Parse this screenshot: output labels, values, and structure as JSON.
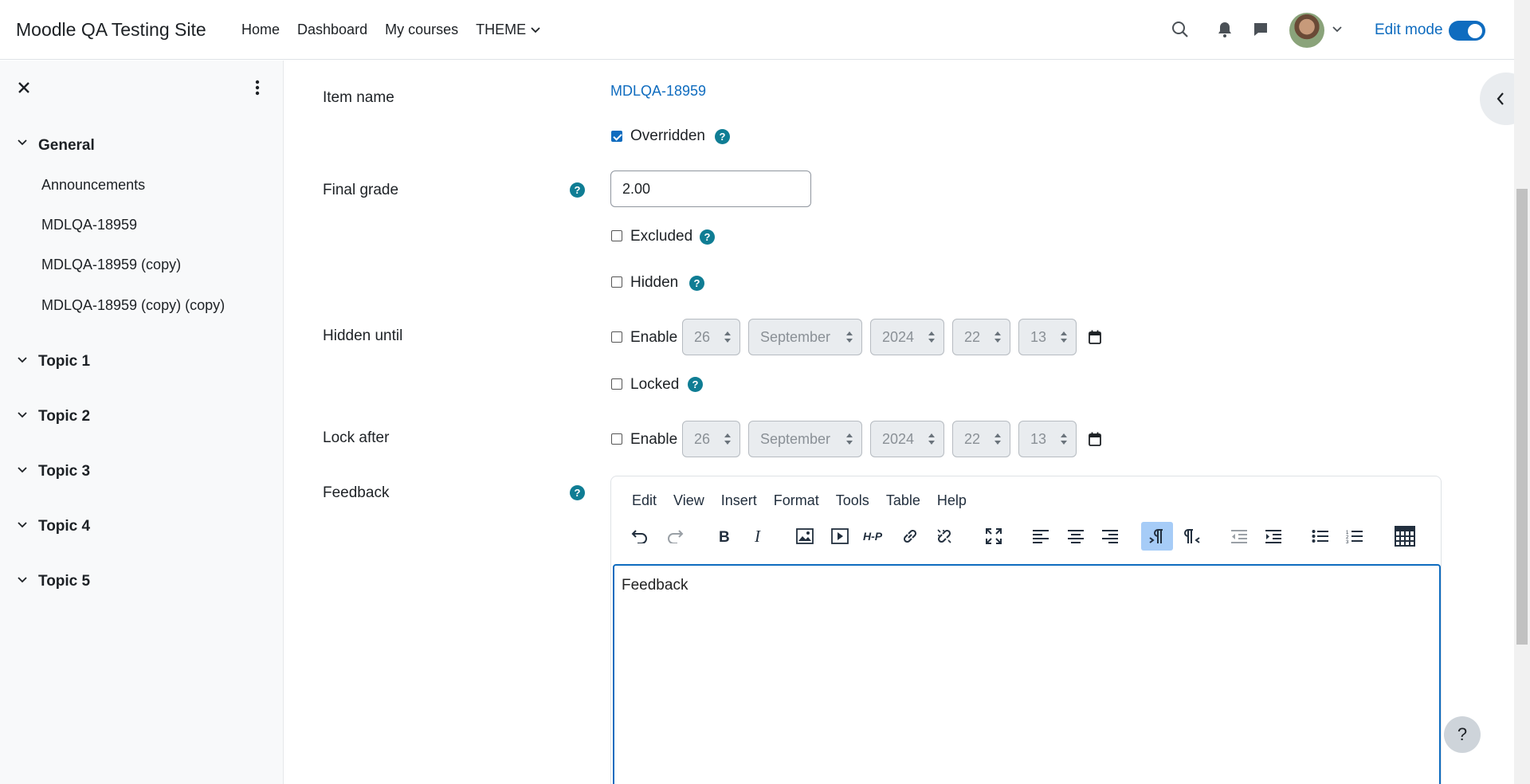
{
  "site": {
    "name": "Moodle QA Testing Site"
  },
  "nav": {
    "items": [
      "Home",
      "Dashboard",
      "My courses",
      "THEME"
    ],
    "edit_mode_label": "Edit mode",
    "edit_mode_on": true
  },
  "sidebar": {
    "sections": [
      {
        "title": "General",
        "items": [
          "Announcements",
          "MDLQA-18959",
          "MDLQA-18959 (copy)",
          "MDLQA-18959 (copy) (copy)"
        ]
      },
      {
        "title": "Topic 1"
      },
      {
        "title": "Topic 2"
      },
      {
        "title": "Topic 3"
      },
      {
        "title": "Topic 4"
      },
      {
        "title": "Topic 5"
      }
    ]
  },
  "form": {
    "item_name_label": "Item name",
    "item_name_value": "MDLQA-18959",
    "overridden_label": "Overridden",
    "overridden_checked": true,
    "final_grade_label": "Final grade",
    "final_grade_value": "2.00",
    "excluded_label": "Excluded",
    "hidden_label": "Hidden",
    "hidden_until_label": "Hidden until",
    "enable_label": "Enable",
    "locked_label": "Locked",
    "lock_after_label": "Lock after",
    "date": {
      "day": "26",
      "month": "September",
      "year": "2024",
      "hour": "22",
      "minute": "13"
    },
    "feedback_label": "Feedback"
  },
  "editor": {
    "menu": [
      "Edit",
      "View",
      "Insert",
      "Format",
      "Tools",
      "Table",
      "Help"
    ],
    "content": "Feedback"
  },
  "help_fab": "?"
}
